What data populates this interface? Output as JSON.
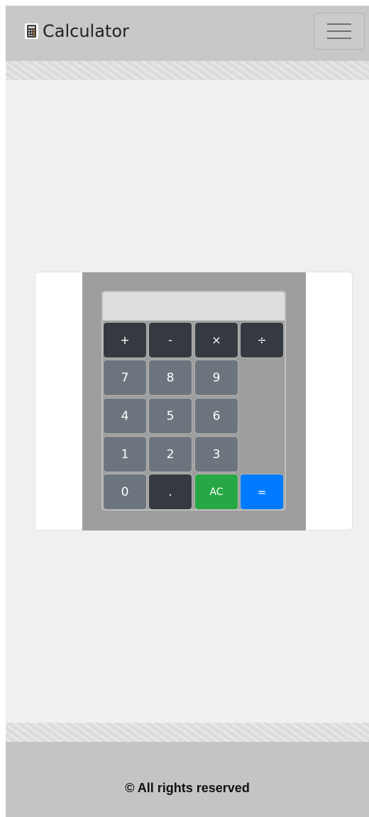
{
  "navbar": {
    "brand_icon": "calculator-icon",
    "brand_title": "Calculator",
    "toggler_icon": "hamburger-menu-icon"
  },
  "calculator": {
    "display_value": "",
    "keys": {
      "plus": "+",
      "minus": "-",
      "multiply": "×",
      "divide": "÷",
      "seven": "7",
      "eight": "8",
      "nine": "9",
      "four": "4",
      "five": "5",
      "six": "6",
      "one": "1",
      "two": "2",
      "three": "3",
      "zero": "0",
      "decimal": ".",
      "clear": "AC",
      "equals": "="
    },
    "colors": {
      "operator": "#343a40",
      "number": "#6c757d",
      "clear": "#28a745",
      "equals": "#007bff"
    }
  },
  "footer": {
    "text": "© All rights reserved"
  }
}
